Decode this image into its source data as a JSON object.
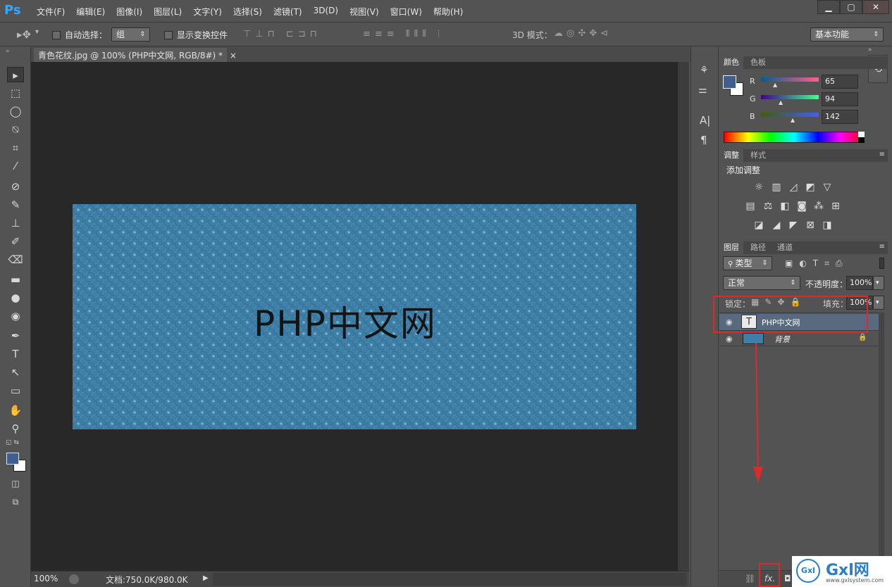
{
  "app": {
    "logo": "Ps",
    "menu": [
      "文件(F)",
      "编辑(E)",
      "图像(I)",
      "图层(L)",
      "文字(Y)",
      "选择(S)",
      "滤镜(T)",
      "3D(D)",
      "视图(V)",
      "窗口(W)",
      "帮助(H)"
    ],
    "window_buttons": [
      "▁",
      "▢",
      "✕"
    ]
  },
  "options": {
    "auto_select_label": "自动选择：",
    "auto_select_value": "组",
    "show_transform_label": "显示变换控件",
    "mode3d_label": "3D 模式：",
    "workspace": "基本功能"
  },
  "document": {
    "tab_title": "青色花纹.jpg @ 100% (PHP中文网, RGB/8#) *",
    "tab_close": "×",
    "canvas_text": "PHP中文网",
    "zoom": "100%",
    "doc_info": "文档:750.0K/980.0K"
  },
  "color_panel": {
    "tabs": [
      "颜色",
      "色板"
    ],
    "r_label": "R",
    "g_label": "G",
    "b_label": "B",
    "r": "65",
    "g": "94",
    "b": "142",
    "fg_color": "#415e8e",
    "bg_color": "#ffffff"
  },
  "adjust_panel": {
    "tabs": [
      "调整",
      "样式"
    ],
    "title": "添加调整"
  },
  "layers_panel": {
    "tabs": [
      "图层",
      "路径",
      "通道"
    ],
    "filter": "类型",
    "blend_mode": "正常",
    "opacity_label": "不透明度：",
    "opacity": "100%",
    "lock_label": "锁定：",
    "fill_label": "填充：",
    "fill": "100%",
    "layers": [
      {
        "name": "PHP中文网",
        "type": "text",
        "thumb": "T"
      },
      {
        "name": "背景",
        "type": "image"
      }
    ],
    "fx_label": "fx."
  },
  "colors": {
    "highlight": "#e0282a",
    "arrow": "#e0282a",
    "image_bg": "#3d7fa6",
    "accent": "#30a8ff"
  },
  "watermark": {
    "text": "Gxl网",
    "sub": "www.gxlsystem.com",
    "badge": "Gxl"
  }
}
